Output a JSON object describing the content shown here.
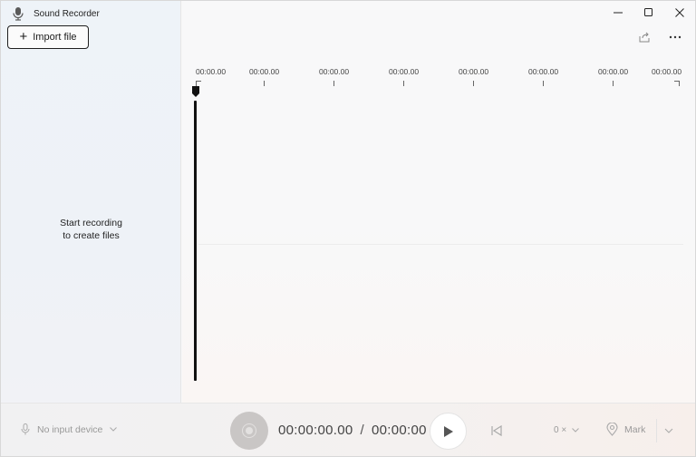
{
  "app": {
    "title": "Sound Recorder"
  },
  "sidebar": {
    "import_label": "Import file",
    "empty_line1": "Start recording",
    "empty_line2": "to create files"
  },
  "timeline": {
    "ticks": [
      "00:00.00",
      "00:00.00",
      "00:00.00",
      "00:00.00",
      "00:00.00",
      "00:00.00",
      "00:00.00",
      "00:00.00"
    ]
  },
  "bottombar": {
    "input_device": "No input device",
    "current_time": "00:00:00.00",
    "separator": "/",
    "total_time": "00:00:00",
    "speed": "0 ×",
    "mark_label": "Mark"
  },
  "colors": {
    "accent": "#1a1a1a",
    "record_disabled": "#c9c6c5",
    "muted_text": "#999999"
  },
  "icons": [
    "microphone-icon",
    "plus-icon",
    "minimize-icon",
    "maximize-icon",
    "close-icon",
    "share-icon",
    "more-icon",
    "play-icon",
    "skip-back-icon",
    "chevron-down-icon",
    "location-pin-icon",
    "record-icon"
  ]
}
